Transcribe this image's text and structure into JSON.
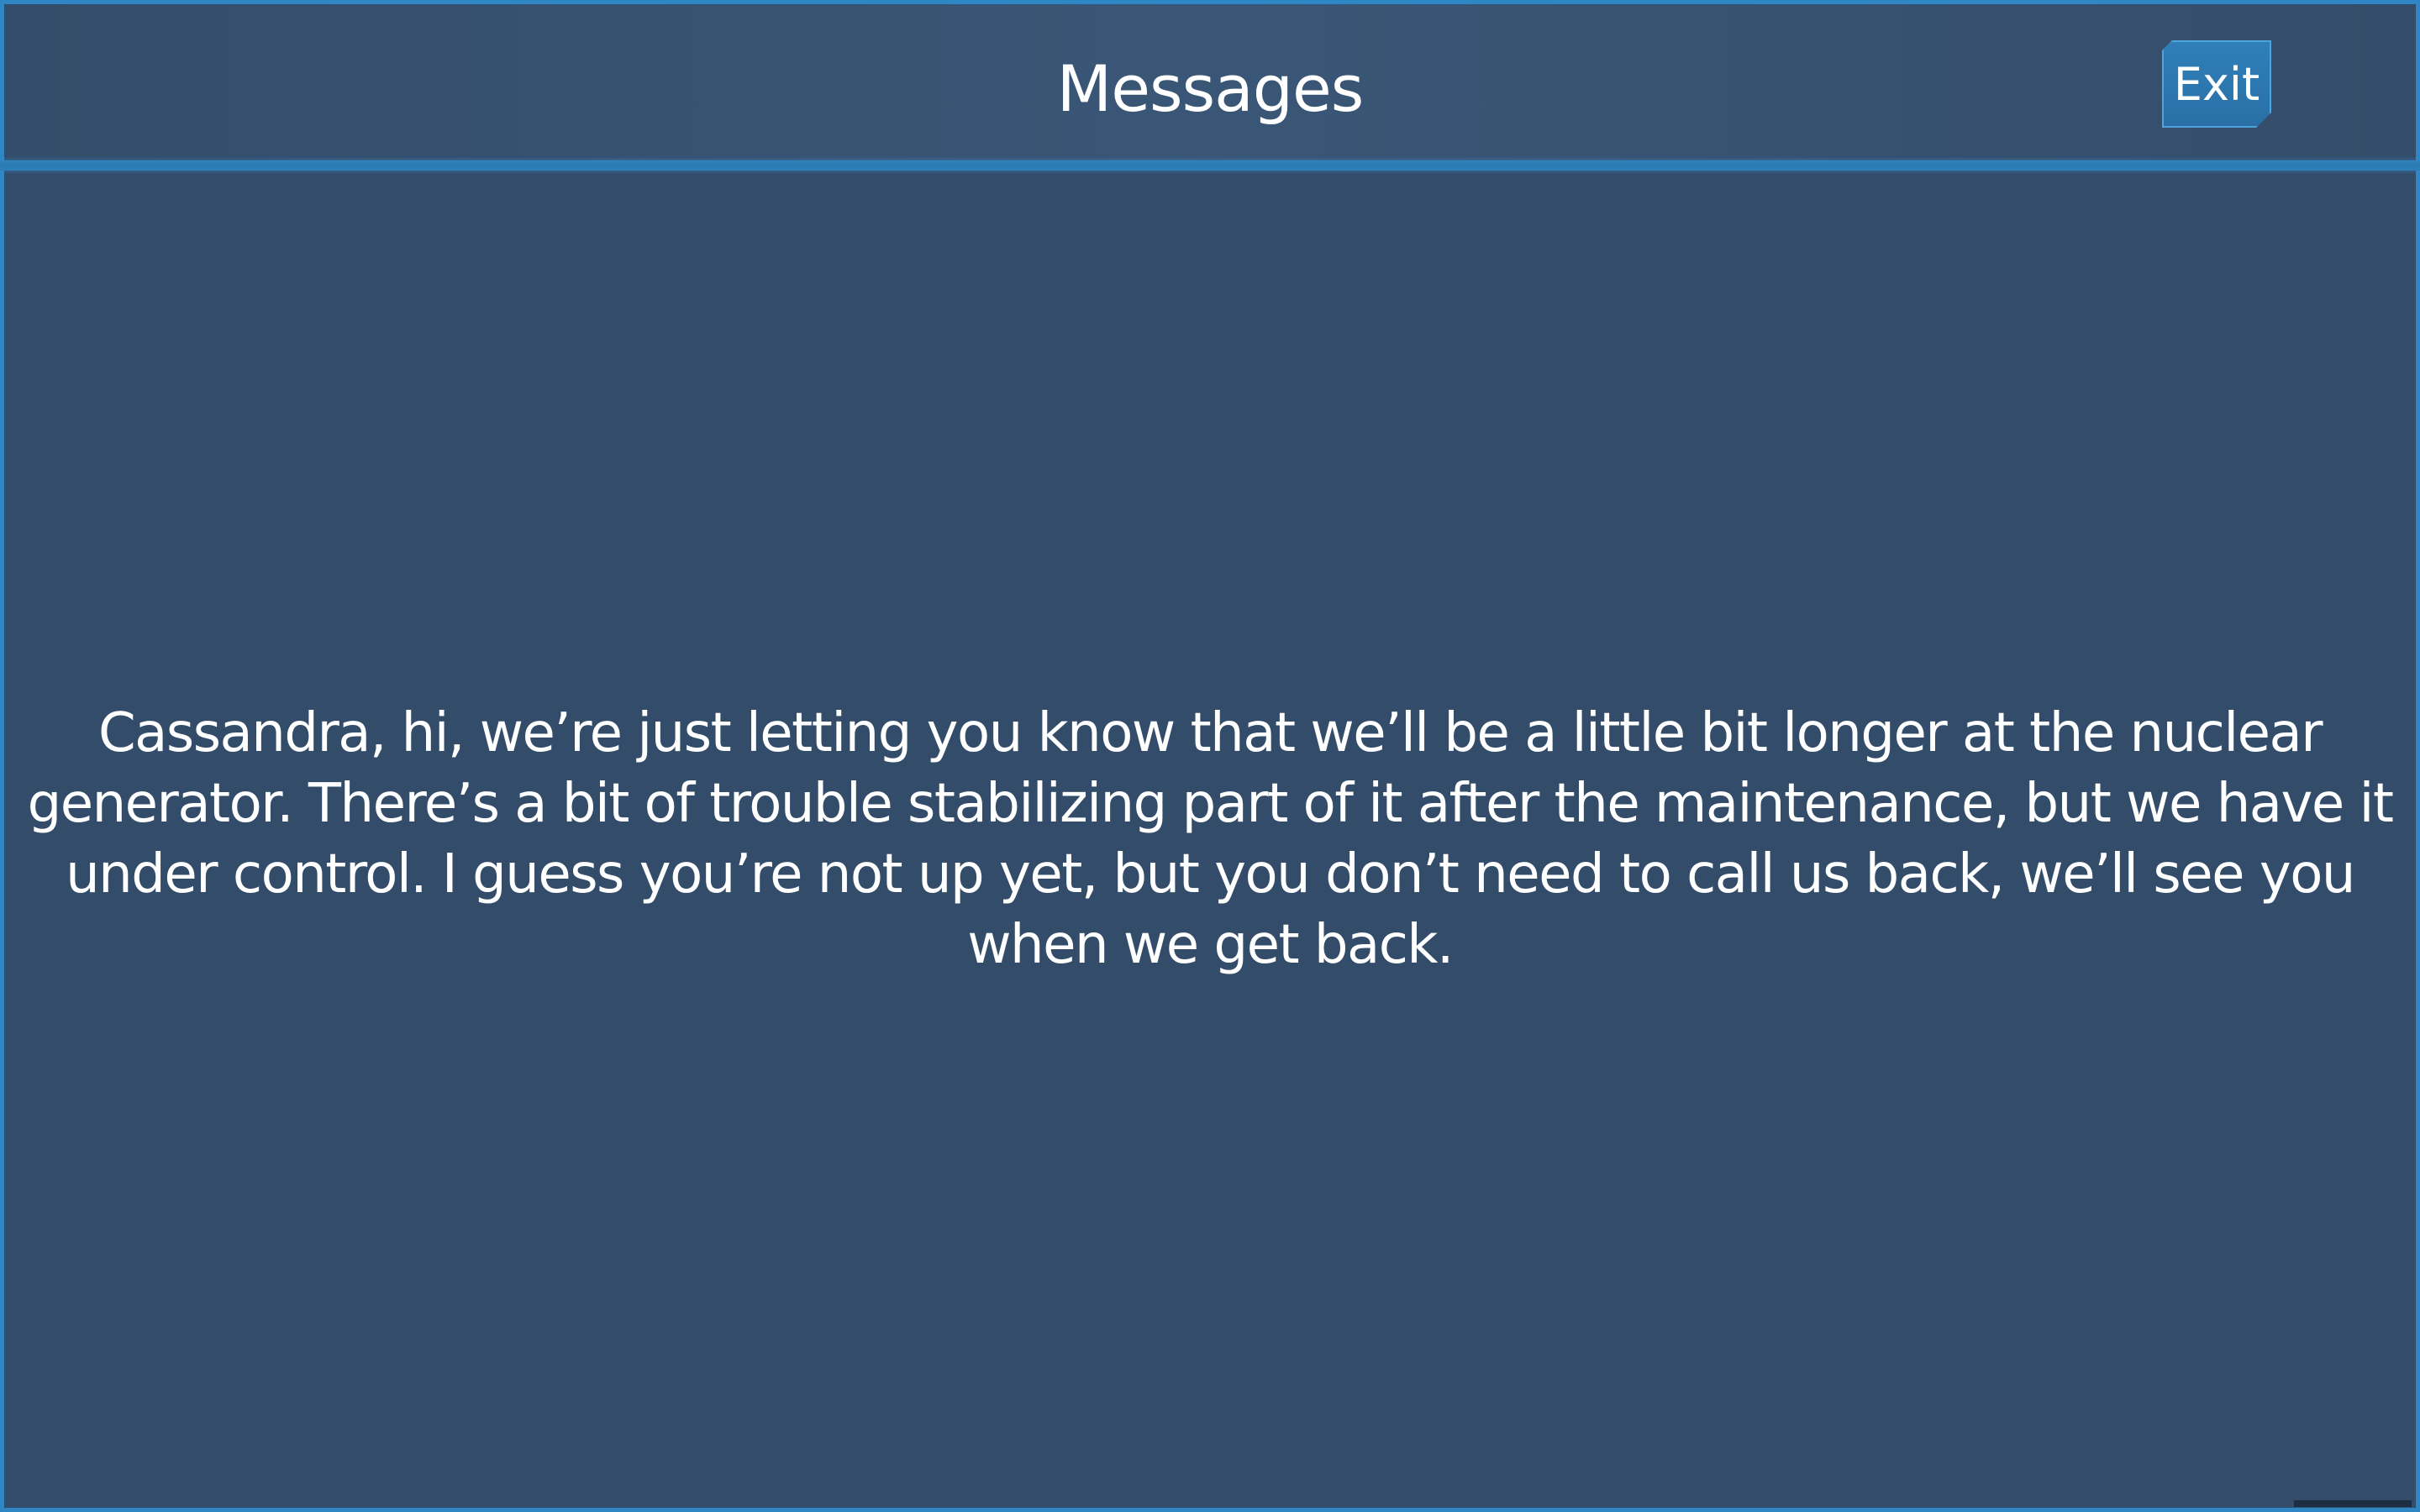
{
  "header": {
    "title": "Messages",
    "exit_label": "Exit"
  },
  "message": {
    "body": "Cassandra, hi, we’re just letting you know that we’ll be a little bit longer at the nuclear generator. There’s a bit of trouble stabilizing part of it after the maintenance, but we have it under control. I guess you’re not up yet, but you don’t need to call us back, we’ll see you when we get back."
  },
  "colors": {
    "background": "#334c6a",
    "frame_border": "#2f86c4",
    "button": "#2f7fb9",
    "text": "#ffffff"
  }
}
